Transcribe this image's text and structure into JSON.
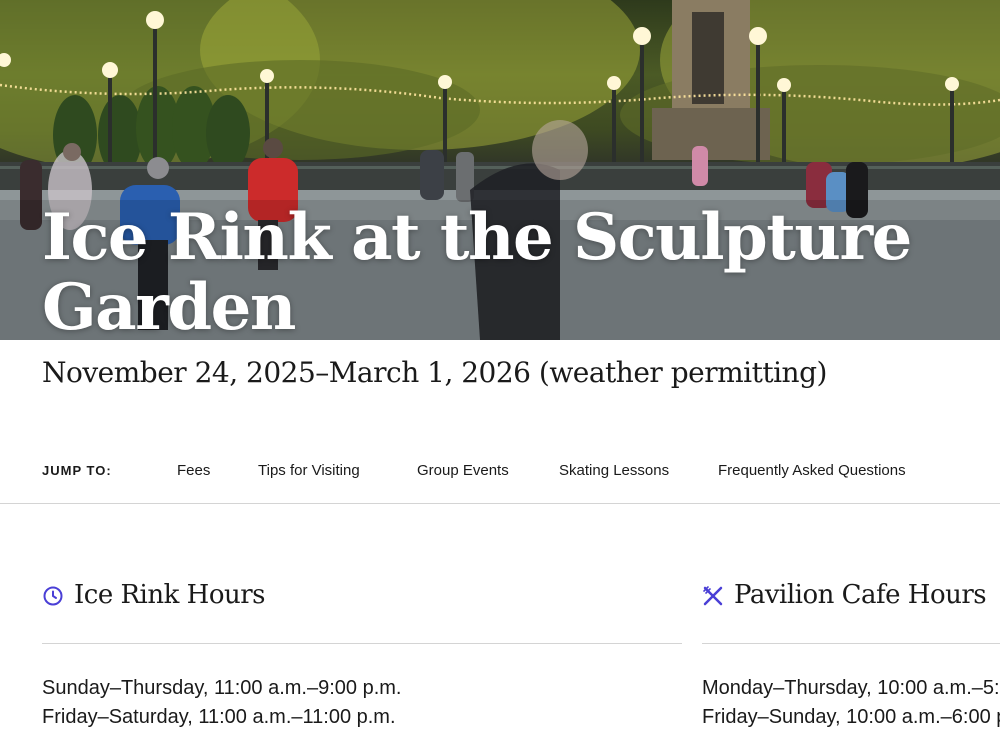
{
  "hero": {
    "title": "Ice Rink at the Sculpture Garden"
  },
  "event": {
    "dates": "November 24, 2025–March 1, 2026 (weather permitting)"
  },
  "jump_nav": {
    "label": "JUMP TO:",
    "links": [
      "Fees",
      "Tips for Visiting",
      "Group Events",
      "Skating Lessons",
      "Frequently Asked Questions"
    ]
  },
  "rink_hours": {
    "icon": "clock-icon",
    "title": "Ice Rink Hours",
    "lines": [
      "Sunday–Thursday, 11:00 a.m.–9:00 p.m.",
      "Friday–Saturday, 11:00 a.m.–11:00 p.m."
    ]
  },
  "cafe_hours": {
    "icon": "utensils-icon",
    "title": "Pavilion Cafe Hours",
    "lines": [
      "Monday–Thursday, 10:00 a.m.–5:",
      "Friday–Sunday, 10:00 a.m.–6:00 p"
    ]
  },
  "colors": {
    "accent": "#4a3fd6",
    "text": "#1a1a1a",
    "divider": "#d4d4d4"
  }
}
